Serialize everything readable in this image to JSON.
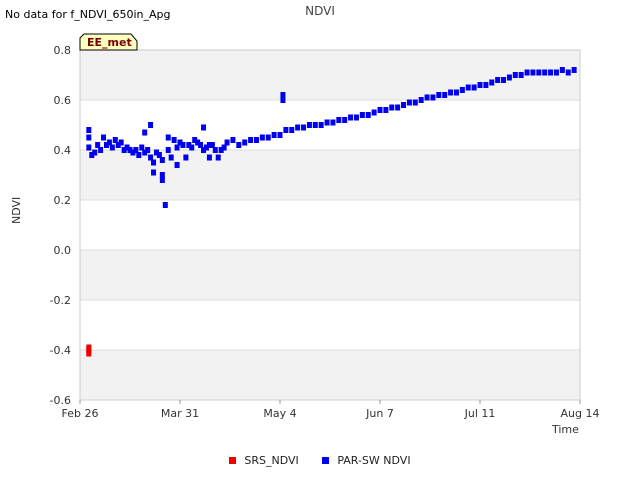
{
  "header": {
    "nodata_text": "No data for f_NDVI_650in_Apg"
  },
  "chart_data": {
    "type": "scatter",
    "title": "NDVI",
    "xlabel": "Time",
    "ylabel": "NDVI",
    "badge": "EE_met",
    "ylim": [
      -0.6,
      0.8
    ],
    "yticks": [
      -0.6,
      -0.4,
      -0.2,
      0.0,
      0.2,
      0.4,
      0.6,
      0.8
    ],
    "ytick_labels": [
      "-0.6",
      "-0.4",
      "-0.2",
      "0.0",
      "0.2",
      "0.4",
      "0.6",
      "0.8"
    ],
    "xlim": [
      "2024-02-26",
      "2024-08-14"
    ],
    "xticks": [
      "2024-02-26",
      "2024-03-31",
      "2024-05-04",
      "2024-06-07",
      "2024-07-11",
      "2024-08-14"
    ],
    "xtick_labels": [
      "Feb 26",
      "Mar 31",
      "May 4",
      "Jun 7",
      "Jul 11",
      "Aug 14"
    ],
    "grid": "alternating horizontal bands",
    "legend": "bottom-center",
    "series": [
      {
        "name": "SRS_NDVI",
        "color": "#ee0000",
        "x": [
          "2024-02-29",
          "2024-02-29",
          "2024-02-29"
        ],
        "y": [
          -0.39,
          -0.4,
          -0.41
        ]
      },
      {
        "name": "PAR-SW NDVI",
        "color": "#0000ee",
        "x": [
          "2024-02-29",
          "2024-02-29",
          "2024-02-29",
          "2024-03-01",
          "2024-03-02",
          "2024-03-03",
          "2024-03-04",
          "2024-03-05",
          "2024-03-06",
          "2024-03-07",
          "2024-03-08",
          "2024-03-09",
          "2024-03-10",
          "2024-03-11",
          "2024-03-12",
          "2024-03-13",
          "2024-03-14",
          "2024-03-15",
          "2024-03-16",
          "2024-03-17",
          "2024-03-18",
          "2024-03-19",
          "2024-03-20",
          "2024-03-21",
          "2024-03-22",
          "2024-03-22",
          "2024-03-23",
          "2024-03-24",
          "2024-03-25",
          "2024-03-25",
          "2024-03-26",
          "2024-03-27",
          "2024-03-28",
          "2024-03-29",
          "2024-03-30",
          "2024-03-31",
          "2024-04-01",
          "2024-04-02",
          "2024-04-03",
          "2024-04-04",
          "2024-04-05",
          "2024-04-06",
          "2024-04-07",
          "2024-04-08",
          "2024-04-09",
          "2024-04-10",
          "2024-04-11",
          "2024-04-12",
          "2024-04-13",
          "2024-04-14",
          "2024-04-15",
          "2024-04-16",
          "2024-04-18",
          "2024-04-20",
          "2024-04-22",
          "2024-04-24",
          "2024-04-26",
          "2024-04-28",
          "2024-04-30",
          "2024-05-02",
          "2024-05-04",
          "2024-05-05",
          "2024-05-05",
          "2024-05-06",
          "2024-05-08",
          "2024-05-10",
          "2024-05-12",
          "2024-05-14",
          "2024-05-16",
          "2024-05-18",
          "2024-05-20",
          "2024-05-22",
          "2024-05-24",
          "2024-05-26",
          "2024-05-28",
          "2024-05-30",
          "2024-06-01",
          "2024-06-03",
          "2024-06-05",
          "2024-06-07",
          "2024-06-09",
          "2024-06-11",
          "2024-06-13",
          "2024-06-15",
          "2024-06-17",
          "2024-06-19",
          "2024-06-21",
          "2024-06-23",
          "2024-06-25",
          "2024-06-27",
          "2024-06-29",
          "2024-07-01",
          "2024-07-03",
          "2024-07-05",
          "2024-07-07",
          "2024-07-09",
          "2024-07-11",
          "2024-07-13",
          "2024-07-15",
          "2024-07-17",
          "2024-07-19",
          "2024-07-21",
          "2024-07-23",
          "2024-07-25",
          "2024-07-27",
          "2024-07-29",
          "2024-07-31",
          "2024-08-02",
          "2024-08-04",
          "2024-08-06",
          "2024-08-08",
          "2024-08-10",
          "2024-08-12",
          "2024-03-19",
          "2024-03-21",
          "2024-03-25",
          "2024-03-27",
          "2024-03-30",
          "2024-04-08",
          "2024-04-10"
        ],
        "y": [
          0.48,
          0.45,
          0.41,
          0.38,
          0.39,
          0.42,
          0.4,
          0.45,
          0.42,
          0.43,
          0.41,
          0.44,
          0.42,
          0.43,
          0.4,
          0.41,
          0.4,
          0.39,
          0.4,
          0.38,
          0.41,
          0.39,
          0.4,
          0.37,
          0.35,
          0.31,
          0.39,
          0.38,
          0.3,
          0.28,
          0.18,
          0.4,
          0.37,
          0.44,
          0.41,
          0.43,
          0.42,
          0.37,
          0.42,
          0.41,
          0.44,
          0.43,
          0.42,
          0.4,
          0.41,
          0.42,
          0.42,
          0.4,
          0.37,
          0.4,
          0.41,
          0.43,
          0.44,
          0.42,
          0.43,
          0.44,
          0.44,
          0.45,
          0.45,
          0.46,
          0.46,
          0.62,
          0.6,
          0.48,
          0.48,
          0.49,
          0.49,
          0.5,
          0.5,
          0.5,
          0.51,
          0.51,
          0.52,
          0.52,
          0.53,
          0.53,
          0.54,
          0.54,
          0.55,
          0.56,
          0.56,
          0.57,
          0.57,
          0.58,
          0.59,
          0.59,
          0.6,
          0.61,
          0.61,
          0.62,
          0.62,
          0.63,
          0.63,
          0.64,
          0.65,
          0.65,
          0.66,
          0.66,
          0.67,
          0.68,
          0.68,
          0.69,
          0.7,
          0.7,
          0.71,
          0.71,
          0.71,
          0.71,
          0.71,
          0.71,
          0.72,
          0.71,
          0.72,
          0.47,
          0.5,
          0.36,
          0.45,
          0.34,
          0.49,
          0.37
        ]
      }
    ]
  }
}
